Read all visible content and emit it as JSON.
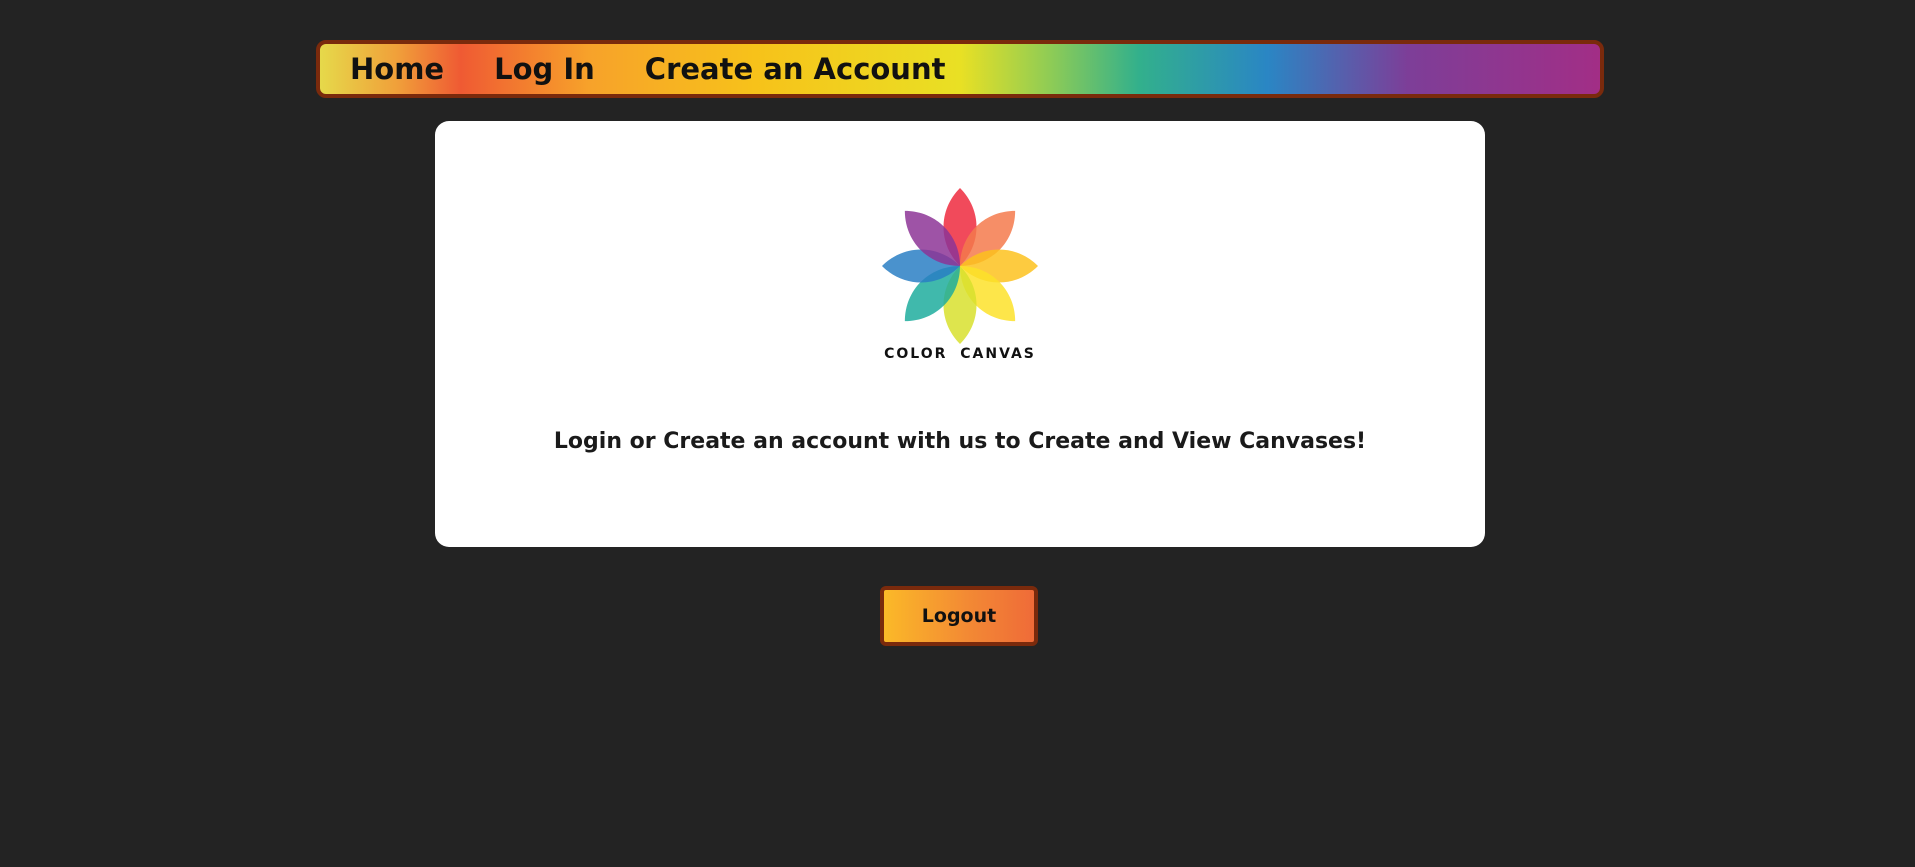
{
  "nav": {
    "home_label": "Home",
    "login_label": "Log In",
    "create_account_label": "Create an Account"
  },
  "logo": {
    "text": "COLOR CANVAS",
    "icon": "flower-logo-icon"
  },
  "main": {
    "tagline": "Login or Create an account with us to Create and View Canvases!"
  },
  "actions": {
    "logout_label": "Logout"
  },
  "colors": {
    "background": "#232323",
    "card": "#ffffff",
    "border": "#7a2a0c",
    "button_start": "#fbb928",
    "button_end": "#ef6b38"
  }
}
